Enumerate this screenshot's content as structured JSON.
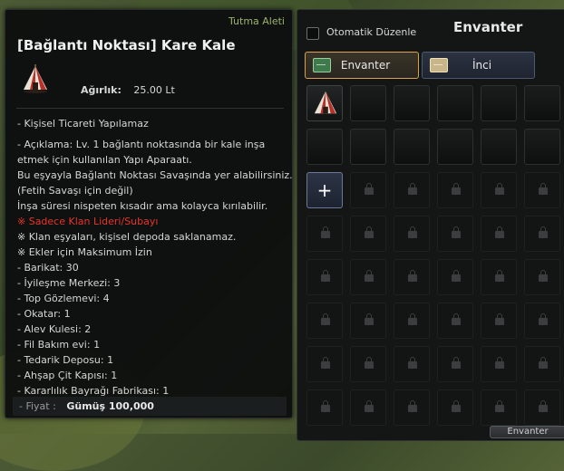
{
  "tooltip": {
    "category": "Tutma Aleti",
    "title": "[Bağlantı Noktası] Kare Kale",
    "item_icon": "tent-fortress-icon",
    "weight_label": "Ağırlık:",
    "weight_value": "25.00 Lt",
    "trade_note": "- Kişisel Ticareti Yapılamaz",
    "description": [
      "- Açıklama: Lv. 1 bağlantı noktasında bir kale inşa",
      "etmek için kullanılan Yapı Aparaatı.",
      "Bu eşyayla Bağlantı Noktası Savaşında yer alabilirsiniz.",
      "(Fetih Savaşı için değil)",
      "İnşa süresi nispeten kısadır ama kolayca kırılabilir."
    ],
    "warning_red": "※ Sadece Klan Lideri/Subayı",
    "notes": [
      "※ Klan eşyaları, kişisel depoda saklanamaz.",
      "※ Ekler için Maksimum İzin"
    ],
    "limits": [
      " - Barikat: 30",
      " - İyileşme Merkezi: 3",
      " - Top Gözlemevi: 4",
      " - Okatar: 1",
      " - Alev Kulesi: 2",
      " - Fil Bakım evi: 1",
      " - Tedarik Deposu: 1",
      " - Ahşap Çit Kapısı: 1",
      " - Kararlılık Bayrağı Fabrikası: 1"
    ],
    "price_label": "- Fiyat :",
    "price_value": "Gümüş 100,000"
  },
  "inventory": {
    "title": "Envanter",
    "auto_sort_label": "Otomatik Düzenle",
    "auto_sort_checked": false,
    "tabs": [
      {
        "label": "Envanter",
        "icon": "green-bag-icon",
        "active": true
      },
      {
        "label": "İnci",
        "icon": "pearl-bag-icon",
        "active": false
      }
    ],
    "expand_symbol": "+",
    "bottom_button_label": "Envanter"
  },
  "colors": {
    "accent_gold": "#d8a24c",
    "category_green": "#9bb36a",
    "warning_red": "#e8342a"
  }
}
